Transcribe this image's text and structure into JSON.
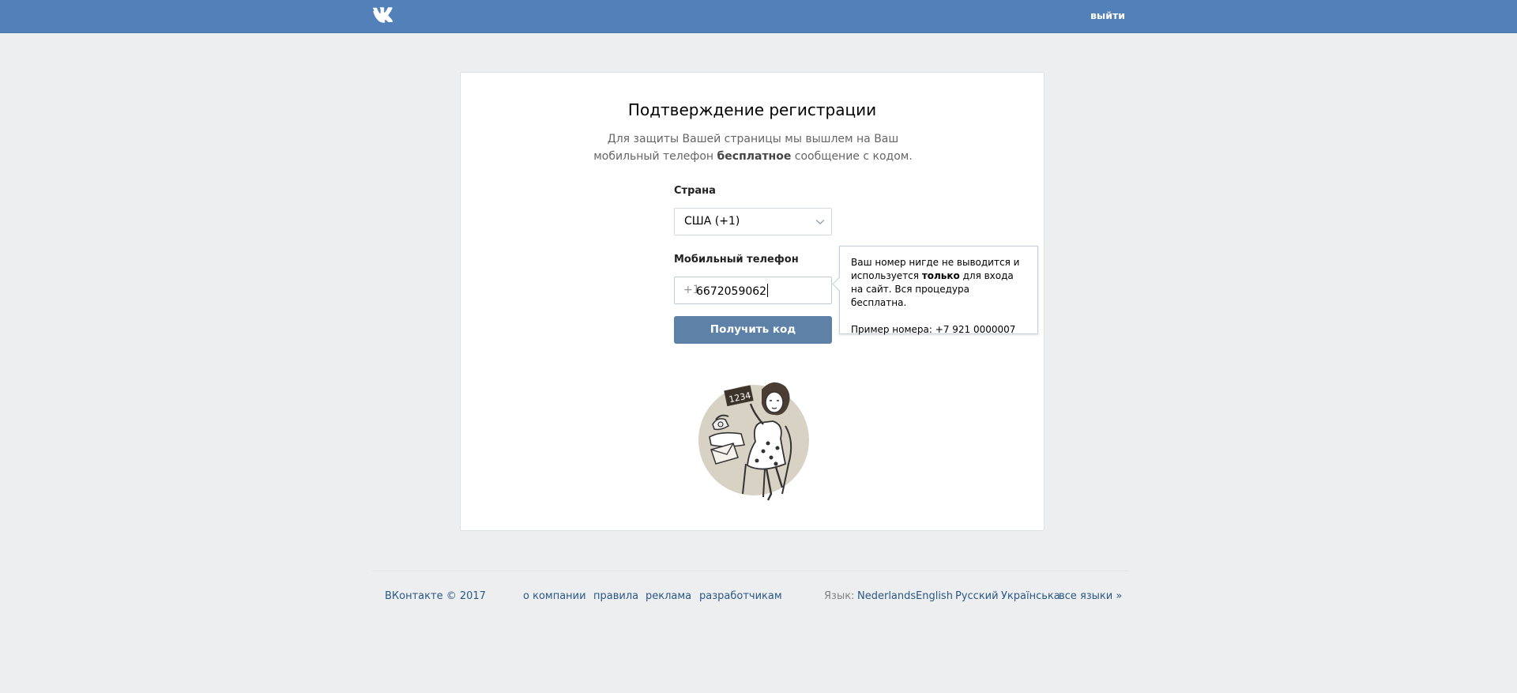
{
  "header": {
    "logo_icon": "vk-logo-icon",
    "logout_label": "выйти",
    "bg_color": "#5181b8"
  },
  "card": {
    "title": "Подтверждение регистрации",
    "subtitle_line1": "Для защиты Вашей страницы мы вышлем на Ваш",
    "subtitle_line2_pre": "мобильный телефон ",
    "subtitle_line2_bold": "бесплатное",
    "subtitle_line2_post": " сообщение с кодом.",
    "country_label": "Страна",
    "country_value": "США (+1)",
    "phone_label": "Мобильный телефон",
    "phone_prefix": "+1",
    "phone_value": "6672059062",
    "submit_label": "Получить код",
    "button_color": "#5e81a8"
  },
  "tooltip": {
    "line_pre": "Ваш номер нигде не выводится и используется ",
    "line_bold": "только",
    "line_post": " для входа на сайт. Вся процедура бесплатна.",
    "example": "Пример номера: +7 921 0000007"
  },
  "illustration": {
    "icon": "woman-with-code-sign-illustration",
    "sign_text": "1234"
  },
  "footer": {
    "copyright": "ВКонтакте © 2017",
    "links": [
      "о компании",
      "правила",
      "реклама",
      "разработчикам"
    ],
    "language_label": "Язык:",
    "languages": [
      "Nederlands",
      "English",
      "Русский",
      "Українська",
      "все языки »"
    ]
  }
}
